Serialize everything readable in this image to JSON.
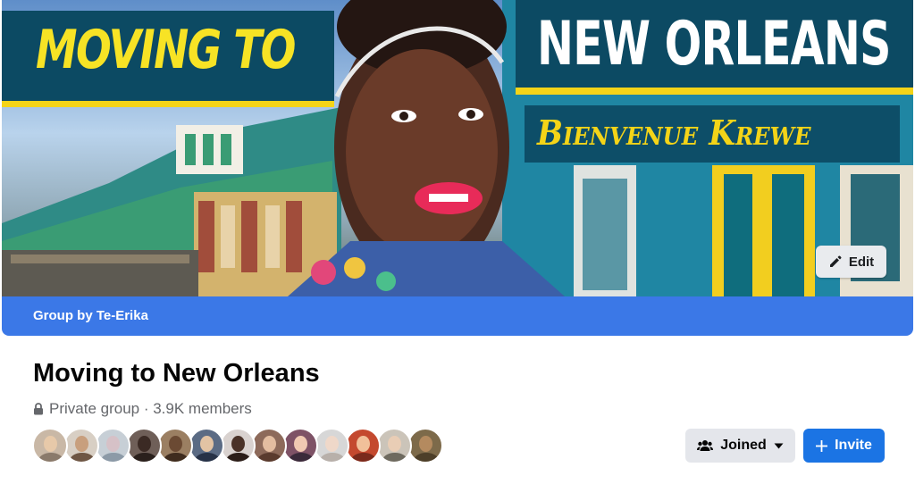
{
  "cover": {
    "headline_left": "MOVING TO",
    "headline_right": "NEW ORLEANS",
    "subheadline": "Bienvenue Krewe",
    "colors": {
      "banner": "#0c4a63",
      "accent": "#f4d418"
    }
  },
  "edit_button": {
    "label": "Edit",
    "icon": "pencil-icon"
  },
  "group_by_bar": {
    "label": "Group by Te-Erika",
    "color": "#3b78e7"
  },
  "group": {
    "name": "Moving to New Orleans",
    "privacy_icon": "lock-icon",
    "meta": "Private group · 3.9K members"
  },
  "member_avatars": [
    {
      "bg": "#c9b8a6",
      "face": "#e7c9a9",
      "body": "#8a7a6b"
    },
    {
      "bg": "#d8cfc4",
      "face": "#c89f7d",
      "body": "#6e5644"
    },
    {
      "bg": "#c7cfd6",
      "face": "#d6c1c7",
      "body": "#8c9aa7"
    },
    {
      "bg": "#6f5f58",
      "face": "#3b2a24",
      "body": "#2a201c"
    },
    {
      "bg": "#9b7f62",
      "face": "#6b4a33",
      "body": "#3f2c1e"
    },
    {
      "bg": "#5b6b84",
      "face": "#e2c3a4",
      "body": "#273247"
    },
    {
      "bg": "#d9d2cf",
      "face": "#4a3228",
      "body": "#2b1d18"
    },
    {
      "bg": "#8d6a5a",
      "face": "#e3bda0",
      "body": "#5a3b2e"
    },
    {
      "bg": "#7e5266",
      "face": "#f0c9b2",
      "body": "#3a2a3a"
    },
    {
      "bg": "#d7d7d7",
      "face": "#efd8c9",
      "body": "#b8b0aa"
    },
    {
      "bg": "#c4492f",
      "face": "#f1c09a",
      "body": "#7a2a1c"
    },
    {
      "bg": "#cbc4b9",
      "face": "#e9cdb5",
      "body": "#6e6a5f"
    },
    {
      "bg": "#7d6a4a",
      "face": "#b48a5f",
      "body": "#4d3f29"
    }
  ],
  "actions": {
    "joined_label": "Joined",
    "joined_icon": "members-icon",
    "joined_caret": "caret-down-icon",
    "invite_label": "Invite",
    "invite_icon": "plus-icon"
  }
}
